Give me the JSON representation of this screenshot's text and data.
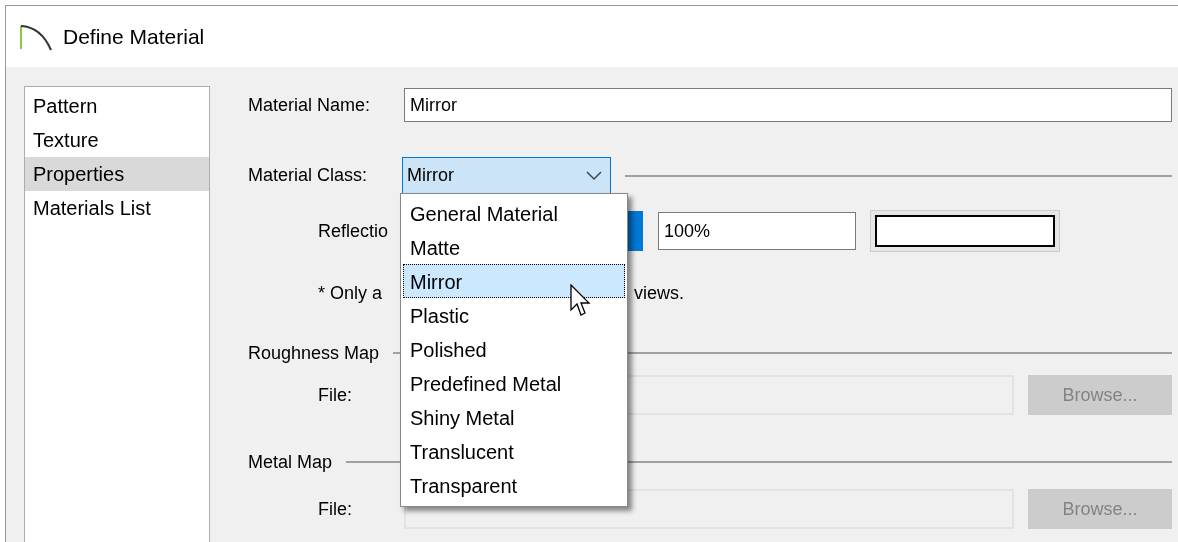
{
  "window": {
    "title": "Define Material"
  },
  "sidebar": {
    "items": [
      {
        "label": "Pattern",
        "selected": false
      },
      {
        "label": "Texture",
        "selected": false
      },
      {
        "label": "Properties",
        "selected": true
      },
      {
        "label": "Materials List",
        "selected": false
      }
    ]
  },
  "material_name": {
    "label": "Material Name:",
    "value": "Mirror"
  },
  "material_class": {
    "label": "Material Class:",
    "value": "Mirror",
    "expanded": true,
    "options": [
      {
        "label": "General Material",
        "selected": false
      },
      {
        "label": "Matte",
        "selected": false
      },
      {
        "label": "Mirror",
        "selected": true
      },
      {
        "label": "Plastic",
        "selected": false
      },
      {
        "label": "Polished",
        "selected": false
      },
      {
        "label": "Predefined Metal",
        "selected": false
      },
      {
        "label": "Shiny Metal",
        "selected": false
      },
      {
        "label": "Translucent",
        "selected": false
      },
      {
        "label": "Transparent",
        "selected": false
      }
    ]
  },
  "reflection": {
    "label": "Reflectio",
    "value": "100%"
  },
  "note": {
    "left": "* Only a",
    "right": "views."
  },
  "maps": [
    {
      "title": "Roughness Map",
      "file_label": "File:",
      "browse": "Browse...",
      "disabled": true
    },
    {
      "title": "Metal Map",
      "file_label": "File:",
      "browse": "Browse...",
      "disabled": true
    }
  ]
}
